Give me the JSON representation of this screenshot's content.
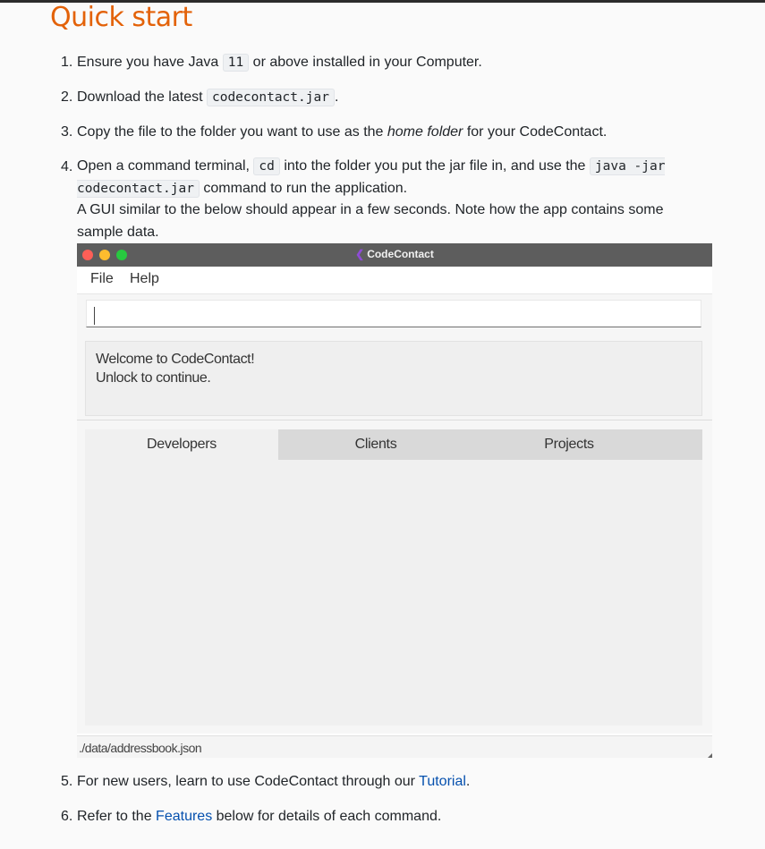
{
  "heading": "Quick start",
  "steps": [
    {
      "num": "1.",
      "pre": "Ensure you have Java ",
      "code": "11",
      "post": " or above installed in your Computer."
    },
    {
      "num": "2.",
      "pre": "Download the latest ",
      "code": "codecontact.jar",
      "post": "."
    },
    {
      "num": "3.",
      "pre": "Copy the file to the folder you want to use as the ",
      "em": "home folder",
      "post": " for your CodeContact."
    },
    {
      "num": "4.",
      "pre": "Open a command terminal, ",
      "code1": "cd",
      "mid": " into the folder you put the jar file in, and use the ",
      "code2": "java -jar codecontact.jar",
      "post": " command to run the application.",
      "line2": "A GUI similar to the below should appear in a few seconds. Note how the app contains some sample data."
    },
    {
      "num": "5.",
      "pre": "For new users, learn to use CodeContact through our ",
      "link": "Tutorial",
      "post": "."
    },
    {
      "num": "6.",
      "pre": "Refer to the ",
      "link": "Features",
      "post": " below for details of each command."
    }
  ],
  "app": {
    "title": "CodeContact",
    "logo_glyph": "❮",
    "traffic_colors": [
      "#ff5f57",
      "#febc2e",
      "#28c840"
    ],
    "menu": [
      "File",
      "Help"
    ],
    "command_value": "",
    "result_line1": "Welcome to CodeContact!",
    "result_line2": "Unlock to continue.",
    "tabs": [
      "Developers",
      "Clients",
      "Projects"
    ],
    "active_tab": "Developers",
    "status": "./data/addressbook.json"
  },
  "colors": {
    "heading": "#e36209",
    "link": "#0550ae"
  }
}
